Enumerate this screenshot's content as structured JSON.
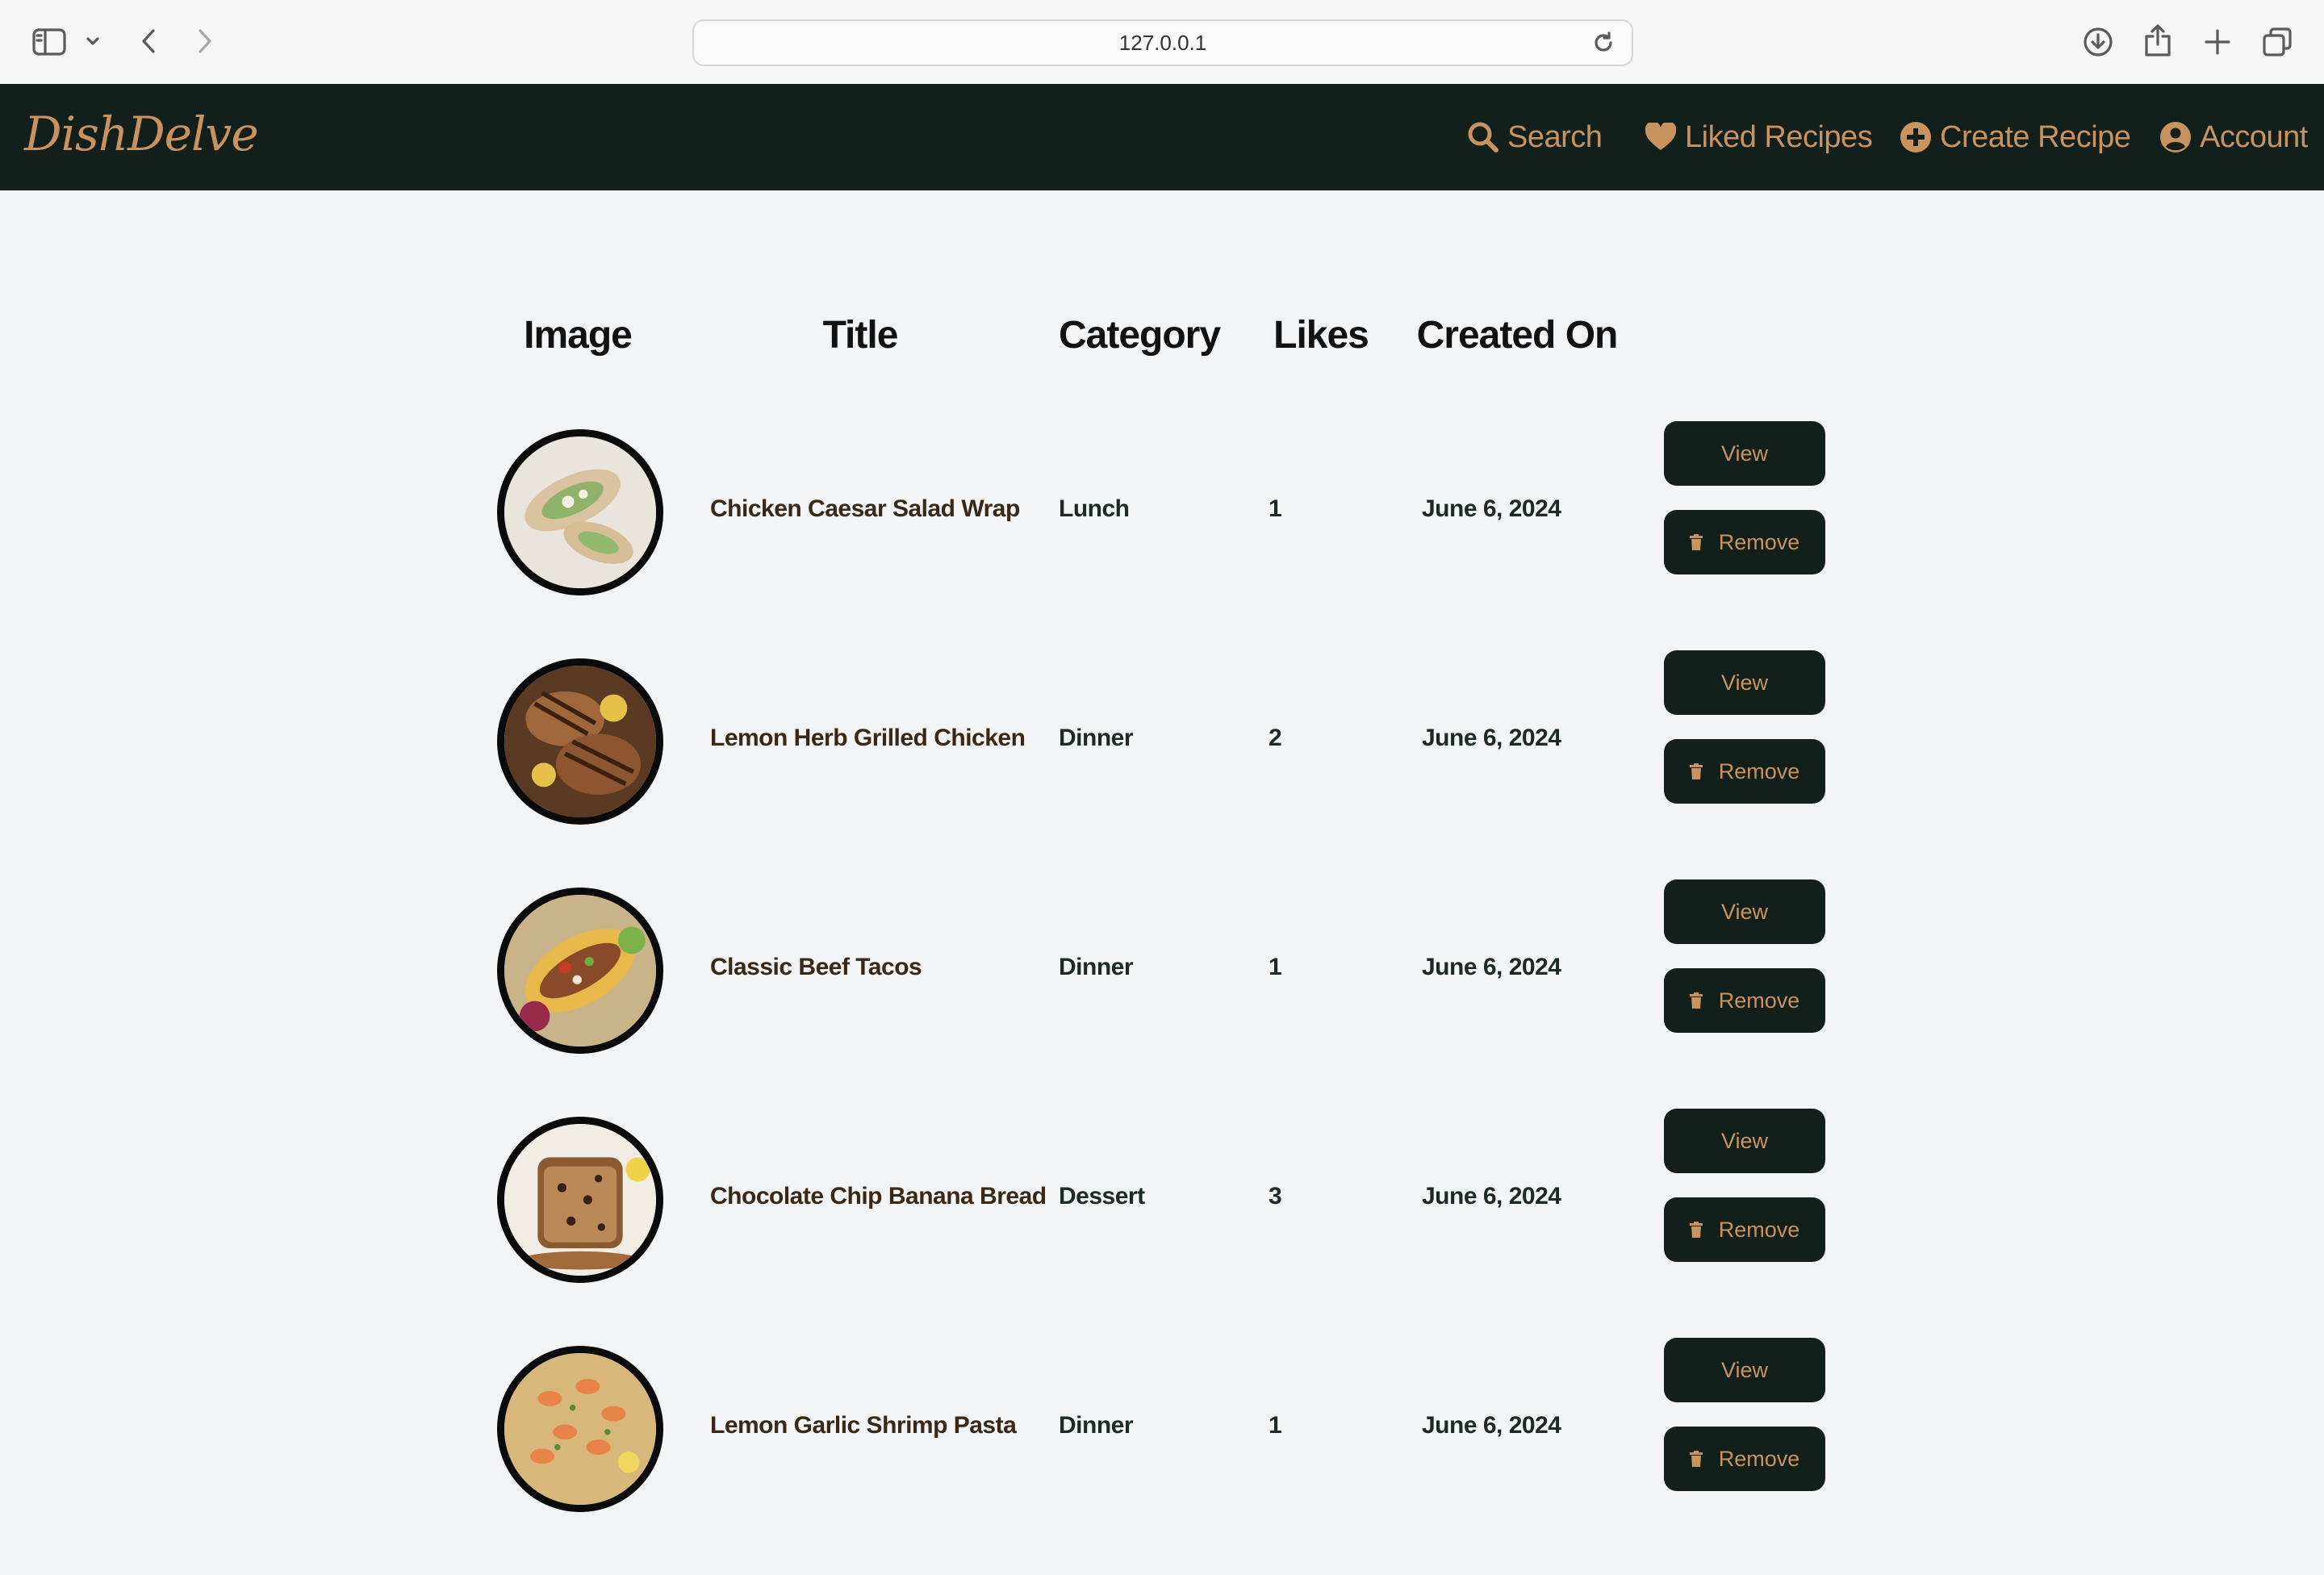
{
  "browser": {
    "url": "127.0.0.1"
  },
  "app": {
    "brand": "DishDelve",
    "nav": {
      "search": "Search",
      "liked": "Liked Recipes",
      "create": "Create Recipe",
      "account": "Account"
    },
    "accent_color": "#c8935f",
    "nav_bg": "#121f1a"
  },
  "table": {
    "headers": {
      "image": "Image",
      "title": "Title",
      "category": "Category",
      "likes": "Likes",
      "created": "Created On"
    },
    "rows": [
      {
        "image": "chicken-caesar-wrap-photo",
        "title": "Chicken Caesar Salad Wrap",
        "category": "Lunch",
        "likes": "1",
        "created": "June 6, 2024",
        "view_label": "View",
        "remove_label": "Remove"
      },
      {
        "image": "grilled-chicken-photo",
        "title": "Lemon Herb Grilled Chicken",
        "category": "Dinner",
        "likes": "2",
        "created": "June 6, 2024",
        "view_label": "View",
        "remove_label": "Remove"
      },
      {
        "image": "beef-tacos-photo",
        "title": "Classic Beef Tacos",
        "category": "Dinner",
        "likes": "1",
        "created": "June 6, 2024",
        "view_label": "View",
        "remove_label": "Remove"
      },
      {
        "image": "banana-bread-photo",
        "title": "Chocolate Chip Banana Bread",
        "category": "Dessert",
        "likes": "3",
        "created": "June 6, 2024",
        "view_label": "View",
        "remove_label": "Remove"
      },
      {
        "image": "shrimp-pasta-photo",
        "title": "Lemon Garlic Shrimp Pasta",
        "category": "Dinner",
        "likes": "1",
        "created": "June 6, 2024",
        "view_label": "View",
        "remove_label": "Remove"
      }
    ]
  }
}
